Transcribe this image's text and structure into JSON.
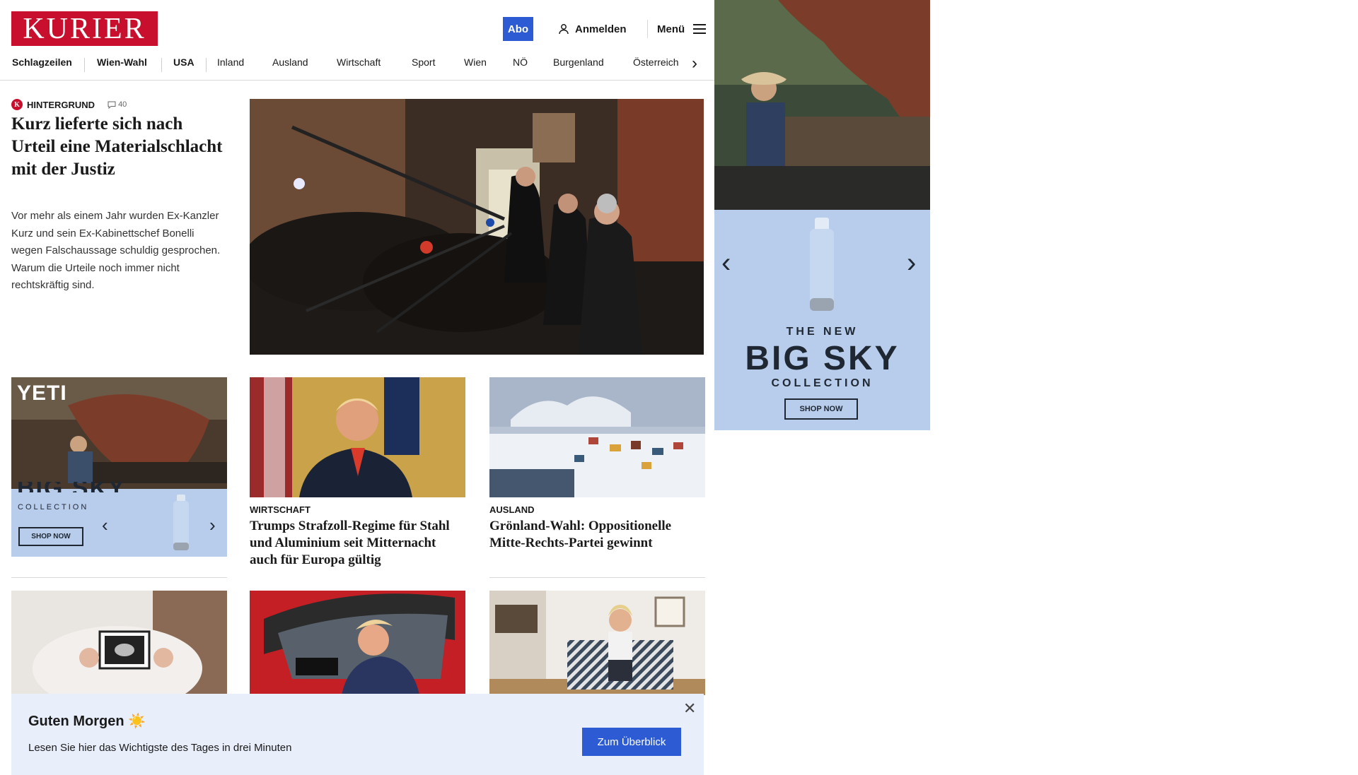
{
  "header": {
    "logo": "KURIER",
    "abo_label": "Abo",
    "login_label": "Anmelden",
    "menu_label": "Menü"
  },
  "nav": {
    "items": [
      "Schlagzeilen",
      "Wien-Wahl",
      "USA",
      "Inland",
      "Ausland",
      "Wirtschaft",
      "Sport",
      "Wien",
      "NÖ",
      "Burgenland",
      "Österreich"
    ]
  },
  "hero": {
    "kicker": "HINTERGRUND",
    "comment_count": "40",
    "title": "Kurz lieferte sich nach Urteil eine Materialschlacht mit der Justiz",
    "teaser": "Vor mehr als einem Jahr wurden Ex-Kanzler Kurz und sein Ex-Kabinettschef Bonelli wegen Falschaussage schuldig gesprochen. Warum die Urteile noch immer nicht rechtskräftig sind."
  },
  "ad_small": {
    "brand": "YETI",
    "headline": "BIG SKY",
    "sub": "COLLECTION",
    "cta": "SHOP NOW"
  },
  "ad_big": {
    "line1": "THE NEW",
    "headline": "BIG SKY",
    "sub": "COLLECTION",
    "cta": "SHOP NOW"
  },
  "cards": [
    {
      "kicker": "WIRTSCHAFT",
      "title": "Trumps Strafzoll-Regime für Stahl und Aluminium seit Mitternacht auch für Europa gültig"
    },
    {
      "kicker": "AUSLAND",
      "title": "Grönland-Wahl: Oppositionelle Mitte-Rechts-Partei gewinnt"
    }
  ],
  "toast": {
    "title": "Guten Morgen ☀️",
    "text": "Lesen Sie hier das Wichtigste des Tages in drei Minuten",
    "button": "Zum Überblick"
  },
  "colors": {
    "brand_red": "#c8102e",
    "accent_blue": "#2d5bd3",
    "ad_blue": "#b7cdeb",
    "toast_bg": "#e8eefa"
  }
}
